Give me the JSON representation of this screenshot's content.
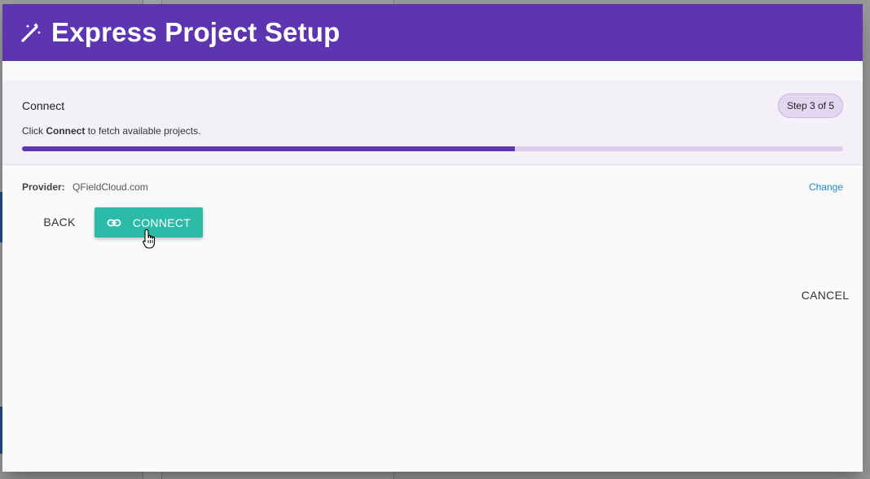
{
  "dialog": {
    "title": "Express Project Setup",
    "header_icon": "magic-wand-icon"
  },
  "step": {
    "title": "Connect",
    "badge": "Step 3 of 5",
    "hint_prefix": "Click",
    "hint_emphasis": "Connect",
    "hint_suffix": "to fetch available projects.",
    "progress_fraction": 0.6
  },
  "provider": {
    "label": "Provider:",
    "value": "QFieldCloud.com",
    "change_label": "Change"
  },
  "actions": {
    "back_label": "BACK",
    "connect_label": "CONNECT",
    "connect_icon": "link-icon",
    "cancel_label": "CANCEL"
  },
  "colors": {
    "header": "#5e35b1",
    "progress": "#5e35b1",
    "connect_button": "#2bbba8",
    "link": "#1e88d0"
  }
}
